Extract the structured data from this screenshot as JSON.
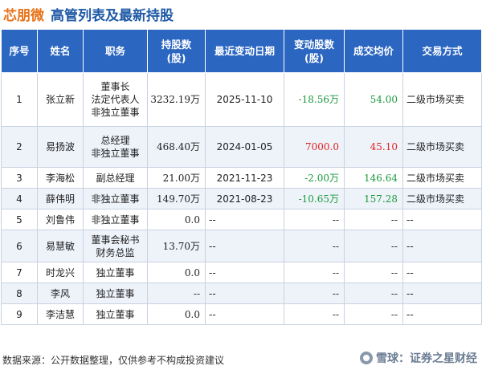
{
  "header": {
    "company": "芯朋微",
    "title": "高管列表及最新持股"
  },
  "watermark": "证券之星",
  "table": {
    "columns": [
      "序号",
      "姓名",
      "职务",
      "持股数\n(股)",
      "最近变动日期",
      "变动股数\n(股)",
      "成交均价",
      "交易方式"
    ],
    "rows": [
      {
        "no": "1",
        "name": "张立新",
        "title": [
          "董事长",
          "法定代表人",
          "非独立董事"
        ],
        "shares": "3232.19万",
        "date": "2025-11-10",
        "change": "-18.56万",
        "change_sign": "neg",
        "price": "54.00",
        "price_color": "neg",
        "method": "二级市场买卖"
      },
      {
        "no": "2",
        "name": "易扬波",
        "title": [
          "总经理",
          "非独立董事"
        ],
        "shares": "468.40万",
        "date": "2024-01-05",
        "change": "7000.0",
        "change_sign": "pos",
        "price": "45.10",
        "price_color": "pos",
        "method": "二级市场买卖"
      },
      {
        "no": "3",
        "name": "李海松",
        "title": [
          "副总经理"
        ],
        "shares": "21.00万",
        "date": "2021-11-23",
        "change": "-2.00万",
        "change_sign": "neg",
        "price": "146.64",
        "price_color": "neg",
        "method": "二级市场买卖"
      },
      {
        "no": "4",
        "name": "薛伟明",
        "title": [
          "非独立董事"
        ],
        "shares": "149.70万",
        "date": "2021-08-23",
        "change": "-10.65万",
        "change_sign": "neg",
        "price": "157.28",
        "price_color": "neg",
        "method": "二级市场买卖"
      },
      {
        "no": "5",
        "name": "刘鲁伟",
        "title": [
          "非独立董事"
        ],
        "shares": "0.0",
        "date": "--",
        "change": "--",
        "change_sign": "none",
        "price": "--",
        "price_color": "none",
        "method": "--"
      },
      {
        "no": "6",
        "name": "易慧敏",
        "title": [
          "董事会秘书",
          "财务总监"
        ],
        "shares": "13.70万",
        "date": "--",
        "change": "--",
        "change_sign": "none",
        "price": "--",
        "price_color": "none",
        "method": "--"
      },
      {
        "no": "7",
        "name": "时龙兴",
        "title": [
          "独立董事"
        ],
        "shares": "0.0",
        "date": "--",
        "change": "--",
        "change_sign": "none",
        "price": "--",
        "price_color": "none",
        "method": "--"
      },
      {
        "no": "8",
        "name": "李风",
        "title": [
          "独立董事"
        ],
        "shares": "--",
        "date": "--",
        "change": "--",
        "change_sign": "none",
        "price": "--",
        "price_color": "none",
        "method": "--"
      },
      {
        "no": "9",
        "name": "李洁慧",
        "title": [
          "独立董事"
        ],
        "shares": "0.0",
        "date": "--",
        "change": "--",
        "change_sign": "none",
        "price": "--",
        "price_color": "none",
        "method": "--"
      }
    ]
  },
  "footer": {
    "source": "数据来源：公开数据整理，仅供参考不构成投资建议",
    "brand": "雪球：证券之星财经"
  },
  "colors": {
    "header_bg": "#2b66c1",
    "company": "#e8731a",
    "title": "#1f5aa6",
    "negative": "#1b9a3c",
    "positive": "#e02020"
  }
}
